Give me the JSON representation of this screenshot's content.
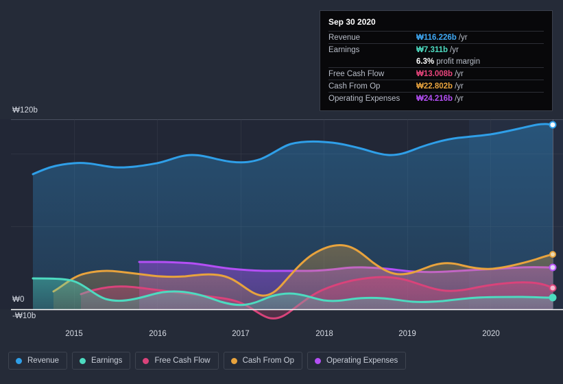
{
  "tooltip": {
    "title": "Sep 30 2020",
    "rows": [
      {
        "key": "Revenue",
        "value": "₩116.226b",
        "unit": "/yr",
        "color": "#3fa9f5"
      },
      {
        "key": "Earnings",
        "value": "₩7.311b",
        "unit": "/yr",
        "color": "#4ddbc0"
      },
      {
        "key": "",
        "value": "6.3%",
        "unit": "profit margin",
        "color": "#ffffff"
      },
      {
        "key": "Free Cash Flow",
        "value": "₩13.008b",
        "unit": "/yr",
        "color": "#e8457c"
      },
      {
        "key": "Cash From Op",
        "value": "₩22.802b",
        "unit": "/yr",
        "color": "#e8a33d"
      },
      {
        "key": "Operating Expenses",
        "value": "₩24.216b",
        "unit": "/yr",
        "color": "#b44ff5"
      }
    ]
  },
  "axes": {
    "y_top_label": "₩120b",
    "y_zero_label": "₩0",
    "y_neg_label": "-₩10b",
    "x_labels": [
      "2015",
      "2016",
      "2017",
      "2018",
      "2019",
      "2020"
    ]
  },
  "legend": [
    {
      "label": "Revenue",
      "color": "#2f9fe8"
    },
    {
      "label": "Earnings",
      "color": "#4ddbc0"
    },
    {
      "label": "Free Cash Flow",
      "color": "#d9437a"
    },
    {
      "label": "Cash From Op",
      "color": "#e8a33d"
    },
    {
      "label": "Operating Expenses",
      "color": "#b44ff5"
    }
  ],
  "chart_data": {
    "type": "area",
    "title": "",
    "xlabel": "",
    "ylabel": "",
    "currency": "KRW (₩)",
    "unit": "billions per year",
    "ylim": [
      -10,
      132
    ],
    "yticks": [
      -10,
      0,
      120
    ],
    "xlim": [
      "2014-07",
      "2020-09"
    ],
    "xticks": [
      "2015",
      "2016",
      "2017",
      "2018",
      "2019",
      "2020"
    ],
    "grid": true,
    "legend_position": "bottom-left",
    "highlight_from": "2020-01",
    "annotation_date": "Sep 30 2020",
    "series": [
      {
        "name": "Revenue",
        "color": "#2f9fe8",
        "x": [
          "2014-07",
          "2014-12",
          "2015-03",
          "2015-06",
          "2015-09",
          "2015-12",
          "2016-03",
          "2016-06",
          "2016-09",
          "2016-12",
          "2017-03",
          "2017-06",
          "2017-09",
          "2017-12",
          "2018-03",
          "2018-06",
          "2018-09",
          "2018-12",
          "2019-03",
          "2019-06",
          "2019-09",
          "2019-12",
          "2020-03",
          "2020-06",
          "2020-09"
        ],
        "values": [
          79.0,
          88.5,
          90.5,
          88.0,
          87.5,
          88.0,
          92.0,
          89.5,
          89.0,
          89.5,
          91.0,
          94.0,
          99.5,
          101.5,
          101.0,
          100.5,
          98.5,
          95.0,
          97.0,
          100.0,
          102.5,
          103.0,
          106.0,
          112.0,
          116.226
        ]
      },
      {
        "name": "Earnings",
        "color": "#4ddbc0",
        "x": [
          "2014-07",
          "2014-12",
          "2015-03",
          "2015-06",
          "2015-09",
          "2015-12",
          "2016-03",
          "2016-06",
          "2016-09",
          "2016-12",
          "2017-03",
          "2017-06",
          "2017-09",
          "2017-12",
          "2018-03",
          "2018-06",
          "2018-09",
          "2018-12",
          "2019-03",
          "2019-06",
          "2019-09",
          "2019-12",
          "2020-03",
          "2020-06",
          "2020-09"
        ],
        "values": [
          6.0,
          5.8,
          5.5,
          4.0,
          1.5,
          0.5,
          0.8,
          1.5,
          2.5,
          3.0,
          2.5,
          0.5,
          -1.5,
          -2.0,
          -1.0,
          1.5,
          3.5,
          3.2,
          2.5,
          1.0,
          0.5,
          1.2,
          3.0,
          5.5,
          7.311
        ]
      },
      {
        "name": "Free Cash Flow",
        "color": "#d9437a",
        "x": [
          "2015-06",
          "2015-09",
          "2015-12",
          "2016-03",
          "2016-06",
          "2016-09",
          "2016-12",
          "2017-03",
          "2017-06",
          "2017-09",
          "2017-12",
          "2018-03",
          "2018-06",
          "2018-09",
          "2018-12",
          "2019-03",
          "2019-06",
          "2019-09",
          "2019-12",
          "2020-03",
          "2020-06",
          "2020-09"
        ],
        "values": [
          1.5,
          3.5,
          3.0,
          2.0,
          1.0,
          0.0,
          -2.5,
          -5.5,
          -6.0,
          -3.0,
          2.0,
          8.0,
          13.5,
          15.5,
          13.0,
          9.5,
          8.0,
          9.0,
          11.0,
          11.5,
          12.2,
          13.008
        ]
      },
      {
        "name": "Cash From Op",
        "color": "#e8a33d",
        "x": [
          "2014-12",
          "2015-03",
          "2015-06",
          "2015-09",
          "2015-12",
          "2016-03",
          "2016-06",
          "2016-09",
          "2016-12",
          "2017-03",
          "2017-06",
          "2017-09",
          "2017-12",
          "2018-03",
          "2018-06",
          "2018-09",
          "2018-12",
          "2019-03",
          "2019-06",
          "2019-09",
          "2019-12",
          "2020-03",
          "2020-06",
          "2020-09"
        ],
        "values": [
          6.0,
          10.5,
          13.0,
          12.5,
          11.5,
          12.0,
          12.5,
          11.0,
          8.0,
          5.0,
          6.5,
          11.0,
          17.5,
          23.0,
          27.5,
          24.0,
          19.5,
          18.5,
          21.0,
          19.0,
          17.5,
          18.0,
          20.5,
          22.802
        ]
      },
      {
        "name": "Operating Expenses",
        "color": "#b44ff5",
        "x": [
          "2015-09",
          "2015-12",
          "2016-03",
          "2016-06",
          "2016-09",
          "2016-12",
          "2017-03",
          "2017-06",
          "2017-09",
          "2017-12",
          "2018-03",
          "2018-06",
          "2018-09",
          "2018-12",
          "2019-03",
          "2019-06",
          "2019-09",
          "2019-12",
          "2020-03",
          "2020-06",
          "2020-09"
        ],
        "values": [
          26.5,
          26.5,
          26.0,
          25.5,
          24.5,
          23.5,
          23.0,
          23.0,
          23.0,
          23.0,
          23.5,
          24.0,
          23.0,
          22.5,
          22.5,
          23.0,
          23.5,
          23.5,
          23.5,
          24.0,
          24.216
        ]
      }
    ]
  }
}
